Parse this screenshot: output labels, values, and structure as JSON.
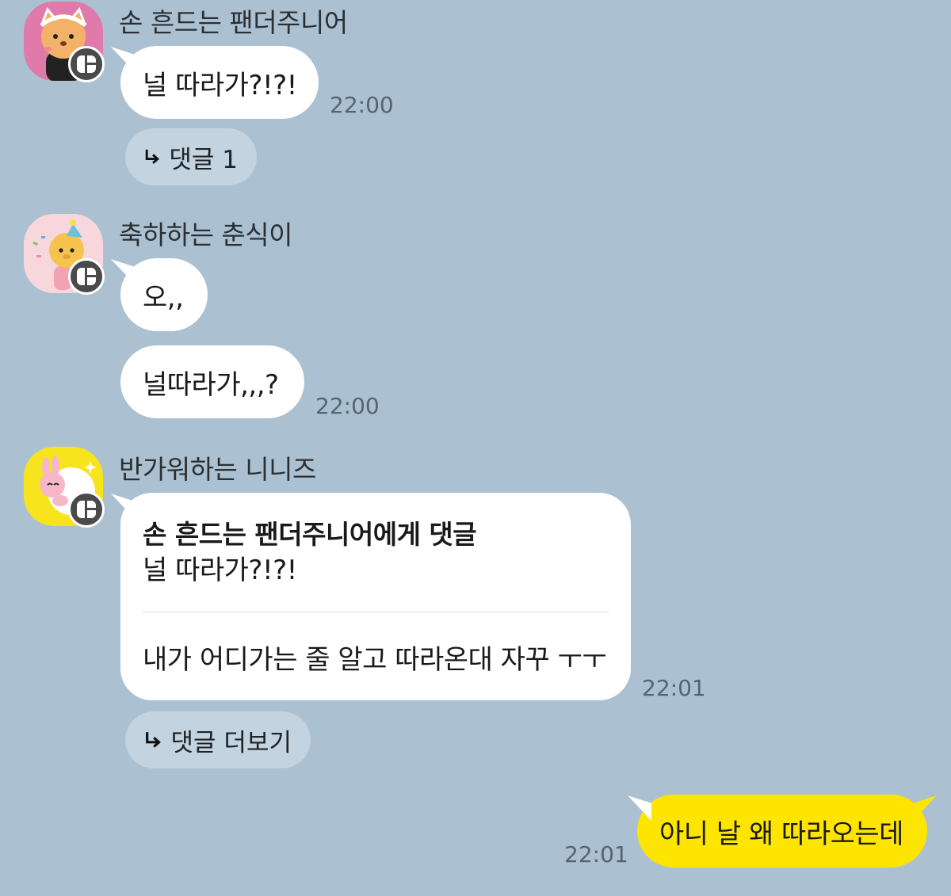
{
  "messages": [
    {
      "sender": "손 흔드는 팬더주니어",
      "text": "널 따라가?!?!",
      "time": "22:00",
      "reply_label": "댓글 1"
    },
    {
      "sender": "축하하는 춘식이",
      "text1": "오,,",
      "text2": "널따라가,,,?",
      "time": "22:00"
    },
    {
      "sender": "반가워하는 니니즈",
      "quote_title": "손 흔드는 팬더주니어에게 댓글",
      "quote_text": "널 따라가?!?!",
      "reply_text": "내가 어디가는 줄 알고 따라온대 자꾸 ㅜㅜ",
      "time": "22:01",
      "reply_label": "댓글 더보기"
    },
    {
      "text": "아니 날 왜 따라오는데",
      "time": "22:01"
    }
  ],
  "colors": {
    "background": "#abc1d1",
    "my_bubble": "#fee500",
    "other_bubble": "#ffffff",
    "reply_chip": "#c3d3df"
  },
  "icons": [
    "reply-arrow-icon",
    "kakao-badge-icon"
  ]
}
